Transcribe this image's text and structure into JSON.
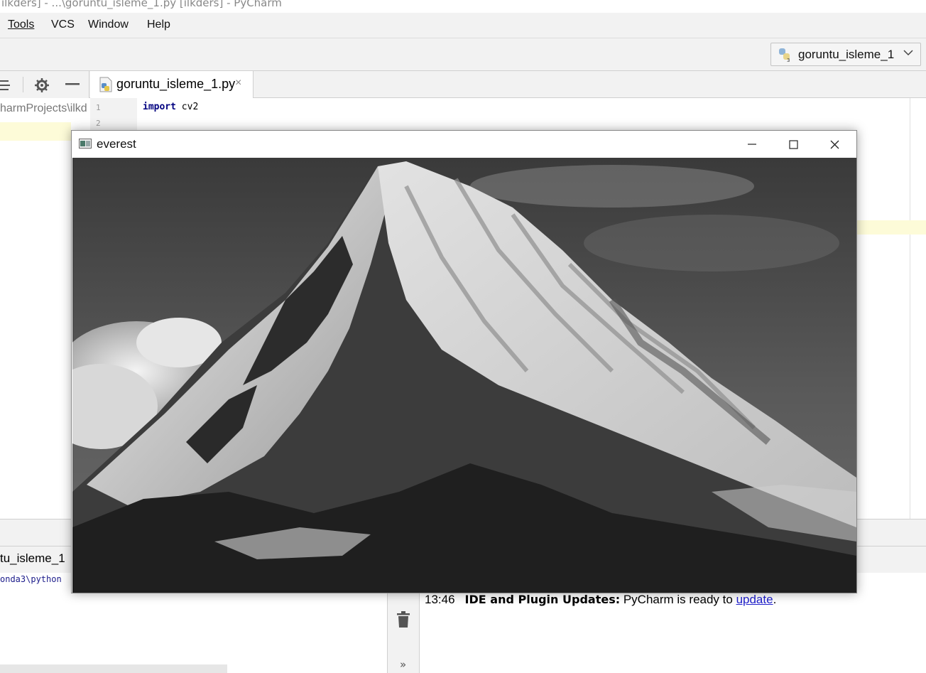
{
  "ide": {
    "window_title": "ilkders] - ...\\goruntu_isleme_1.py [ilkders] - PyCharm",
    "menu": [
      "Tools",
      "VCS",
      "Window",
      "Help"
    ],
    "menu_mnemonic_index": [
      0,
      2,
      0,
      0
    ],
    "run_config": {
      "label": "goruntu_isleme_1",
      "icon": "python-icon"
    },
    "project_path_fragment": "harmProjects\\ilkd",
    "editor_tab": {
      "label": "goruntu_isleme_1.py",
      "close": "×",
      "icon": "python-file-icon"
    },
    "editor": {
      "line_numbers": [
        "1",
        "2"
      ],
      "code_line_1": {
        "keyword": "import",
        "rest": " cv2"
      }
    },
    "run_tab_label": "tu_isleme_1",
    "console_line": "onda3\\python",
    "event_log": {
      "time": "13:46",
      "title": "IDE and Plugin Updates:",
      "message": " PyCharm is ready to ",
      "link": "update",
      "suffix": "."
    },
    "event_toolbar_icons": [
      "trash-icon",
      "expand-more-icon"
    ],
    "expand_glyph": "»"
  },
  "cv_window": {
    "title": "everest",
    "controls": [
      "minimize-icon",
      "maximize-icon",
      "close-icon"
    ],
    "image_subject": "black-and-white photo of a snow-covered mountain peak"
  },
  "colors": {
    "chrome_bg": "#f2f2f2",
    "keyword": "#000080",
    "link": "#2222cc",
    "caret_line": "#fdfbd8"
  }
}
